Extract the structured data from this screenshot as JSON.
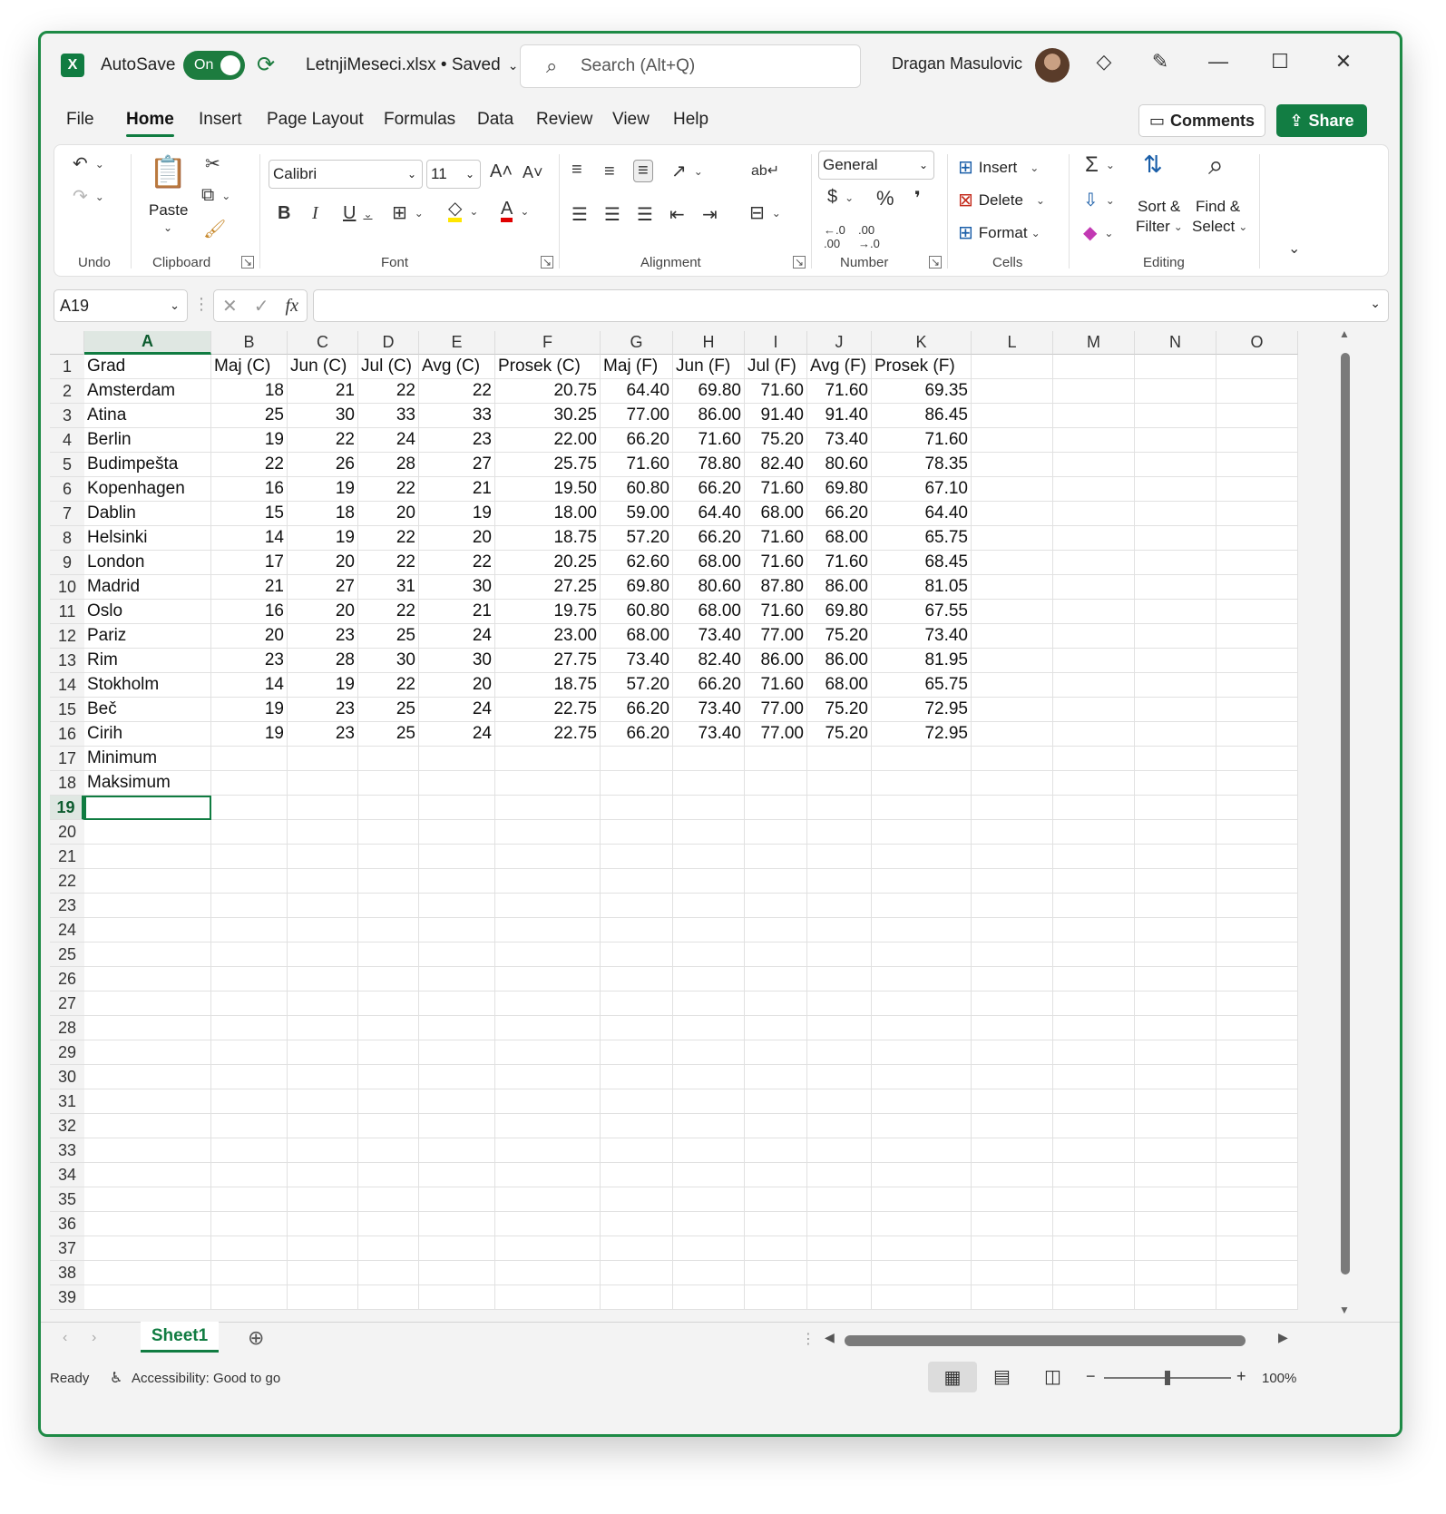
{
  "titlebar": {
    "app_logo": "X",
    "autosave_label": "AutoSave",
    "autosave_state": "On",
    "filename": "LetnjiMeseci.xlsx • Saved",
    "search_placeholder": "Search (Alt+Q)",
    "user_name": "Dragan Masulovic"
  },
  "menu": {
    "tabs": [
      "File",
      "Home",
      "Insert",
      "Page Layout",
      "Formulas",
      "Data",
      "Review",
      "View",
      "Help"
    ],
    "active_tab": "Home",
    "comments_label": "Comments",
    "share_label": "Share"
  },
  "ribbon": {
    "groups": {
      "undo": "Undo",
      "clipboard": "Clipboard",
      "font": "Font",
      "alignment": "Alignment",
      "number": "Number",
      "cells": "Cells",
      "editing": "Editing"
    },
    "paste_label": "Paste",
    "font_name": "Calibri",
    "font_size": "11",
    "number_format": "General",
    "insert_label": "Insert",
    "delete_label": "Delete",
    "format_label": "Format",
    "sort_label_1": "Sort &",
    "sort_label_2": "Filter",
    "find_label_1": "Find &",
    "find_label_2": "Select",
    "bold": "B",
    "italic": "I",
    "underline": "U",
    "currency": "$",
    "percent": "%",
    "comma": "❜",
    "fill_color": "#ffe600",
    "font_color": "#e00000"
  },
  "formula_bar": {
    "name_box": "A19",
    "fx": "fx",
    "value": ""
  },
  "sheet": {
    "columns": [
      "A",
      "B",
      "C",
      "D",
      "E",
      "F",
      "G",
      "H",
      "I",
      "J",
      "K",
      "L",
      "M",
      "N",
      "O"
    ],
    "selected_column": "A",
    "selected_row": "19",
    "row_numbers": [
      "1",
      "2",
      "3",
      "4",
      "5",
      "6",
      "7",
      "8",
      "9",
      "10",
      "11",
      "12",
      "13",
      "14",
      "15",
      "16",
      "17",
      "18",
      "19",
      "20",
      "21",
      "22",
      "23",
      "24",
      "25",
      "26",
      "27",
      "28",
      "29",
      "30",
      "31",
      "32",
      "33",
      "34",
      "35",
      "36",
      "37",
      "38",
      "39"
    ],
    "header_row": [
      "Grad",
      "Maj (C)",
      "Jun (C)",
      "Jul (C)",
      "Avg (C)",
      "Prosek (C)",
      "Maj (F)",
      "Jun (F)",
      "Jul (F)",
      "Avg (F)",
      "Prosek (F)"
    ],
    "rows": [
      [
        "Amsterdam",
        "18",
        "21",
        "22",
        "22",
        "20.75",
        "64.40",
        "69.80",
        "71.60",
        "71.60",
        "69.35"
      ],
      [
        "Atina",
        "25",
        "30",
        "33",
        "33",
        "30.25",
        "77.00",
        "86.00",
        "91.40",
        "91.40",
        "86.45"
      ],
      [
        "Berlin",
        "19",
        "22",
        "24",
        "23",
        "22.00",
        "66.20",
        "71.60",
        "75.20",
        "73.40",
        "71.60"
      ],
      [
        "Budimpešta",
        "22",
        "26",
        "28",
        "27",
        "25.75",
        "71.60",
        "78.80",
        "82.40",
        "80.60",
        "78.35"
      ],
      [
        "Kopenhagen",
        "16",
        "19",
        "22",
        "21",
        "19.50",
        "60.80",
        "66.20",
        "71.60",
        "69.80",
        "67.10"
      ],
      [
        "Dablin",
        "15",
        "18",
        "20",
        "19",
        "18.00",
        "59.00",
        "64.40",
        "68.00",
        "66.20",
        "64.40"
      ],
      [
        "Helsinki",
        "14",
        "19",
        "22",
        "20",
        "18.75",
        "57.20",
        "66.20",
        "71.60",
        "68.00",
        "65.75"
      ],
      [
        "London",
        "17",
        "20",
        "22",
        "22",
        "20.25",
        "62.60",
        "68.00",
        "71.60",
        "71.60",
        "68.45"
      ],
      [
        "Madrid",
        "21",
        "27",
        "31",
        "30",
        "27.25",
        "69.80",
        "80.60",
        "87.80",
        "86.00",
        "81.05"
      ],
      [
        "Oslo",
        "16",
        "20",
        "22",
        "21",
        "19.75",
        "60.80",
        "68.00",
        "71.60",
        "69.80",
        "67.55"
      ],
      [
        "Pariz",
        "20",
        "23",
        "25",
        "24",
        "23.00",
        "68.00",
        "73.40",
        "77.00",
        "75.20",
        "73.40"
      ],
      [
        "Rim",
        "23",
        "28",
        "30",
        "30",
        "27.75",
        "73.40",
        "82.40",
        "86.00",
        "86.00",
        "81.95"
      ],
      [
        "Stokholm",
        "14",
        "19",
        "22",
        "20",
        "18.75",
        "57.20",
        "66.20",
        "71.60",
        "68.00",
        "65.75"
      ],
      [
        "Beč",
        "19",
        "23",
        "25",
        "24",
        "22.75",
        "66.20",
        "73.40",
        "77.00",
        "75.20",
        "72.95"
      ],
      [
        "Cirih",
        "19",
        "23",
        "25",
        "24",
        "22.75",
        "66.20",
        "73.40",
        "77.00",
        "75.20",
        "72.95"
      ],
      [
        "Minimum",
        "",
        "",
        "",
        "",
        "",
        "",
        "",
        "",
        "",
        ""
      ],
      [
        "Maksimum",
        "",
        "",
        "",
        "",
        "",
        "",
        "",
        "",
        "",
        ""
      ]
    ],
    "sheet_tab": "Sheet1"
  },
  "status": {
    "ready": "Ready",
    "accessibility": "Accessibility: Good to go",
    "zoom": "100%",
    "zoom_fraction": 0.5
  }
}
